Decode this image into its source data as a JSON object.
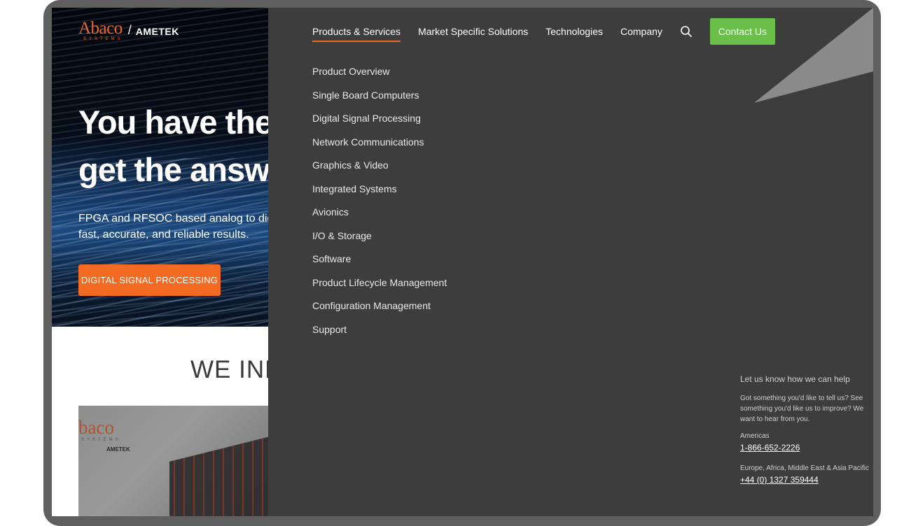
{
  "logo": {
    "brand": "Abaco",
    "tagline": "SYSTEMS",
    "separator": "/",
    "partner": "AMETEK"
  },
  "hero": {
    "title_line1": "You have the",
    "title_line2": "get the answe",
    "subtitle_line1": "FPGA and RFSOC based analog to dig-",
    "subtitle_line2": "fast, accurate, and reliable results.",
    "cta_label": "DIGITAL SIGNAL PROCESSING"
  },
  "section": {
    "heading": "WE INN",
    "thumb_brand": "baco",
    "thumb_tagline": "SYSTEMS",
    "thumb_partner": "AMETEK"
  },
  "nav": {
    "items": [
      {
        "label": "Products & Services",
        "active": true
      },
      {
        "label": "Market Specific Solutions"
      },
      {
        "label": "Technologies"
      },
      {
        "label": "Company"
      }
    ],
    "search_icon": "search-icon",
    "contact_label": "Contact Us"
  },
  "menu": {
    "items": [
      "Product Overview",
      "Single Board Computers",
      "Digital Signal Processing",
      "Network Communications",
      "Graphics & Video",
      "Integrated Systems",
      "Avionics",
      "I/O & Storage",
      "Software",
      "Product Lifecycle Management",
      "Configuration Management",
      "Support"
    ]
  },
  "help": {
    "title": "Let us know how we can help",
    "body": "Got something you'd like to tell us? See something you'd like us to improve? We want to hear from you.",
    "regions": [
      {
        "name": "Americas",
        "phone": "1-866-652-2226"
      },
      {
        "name": "Europe, Africa, Middle East & Asia Pacific",
        "phone": "+44 (0) 1327 359444"
      }
    ]
  },
  "colors": {
    "accent_orange": "#f36b23",
    "contact_green": "#6abf4b",
    "panel_bg": "#3d3d3d"
  }
}
